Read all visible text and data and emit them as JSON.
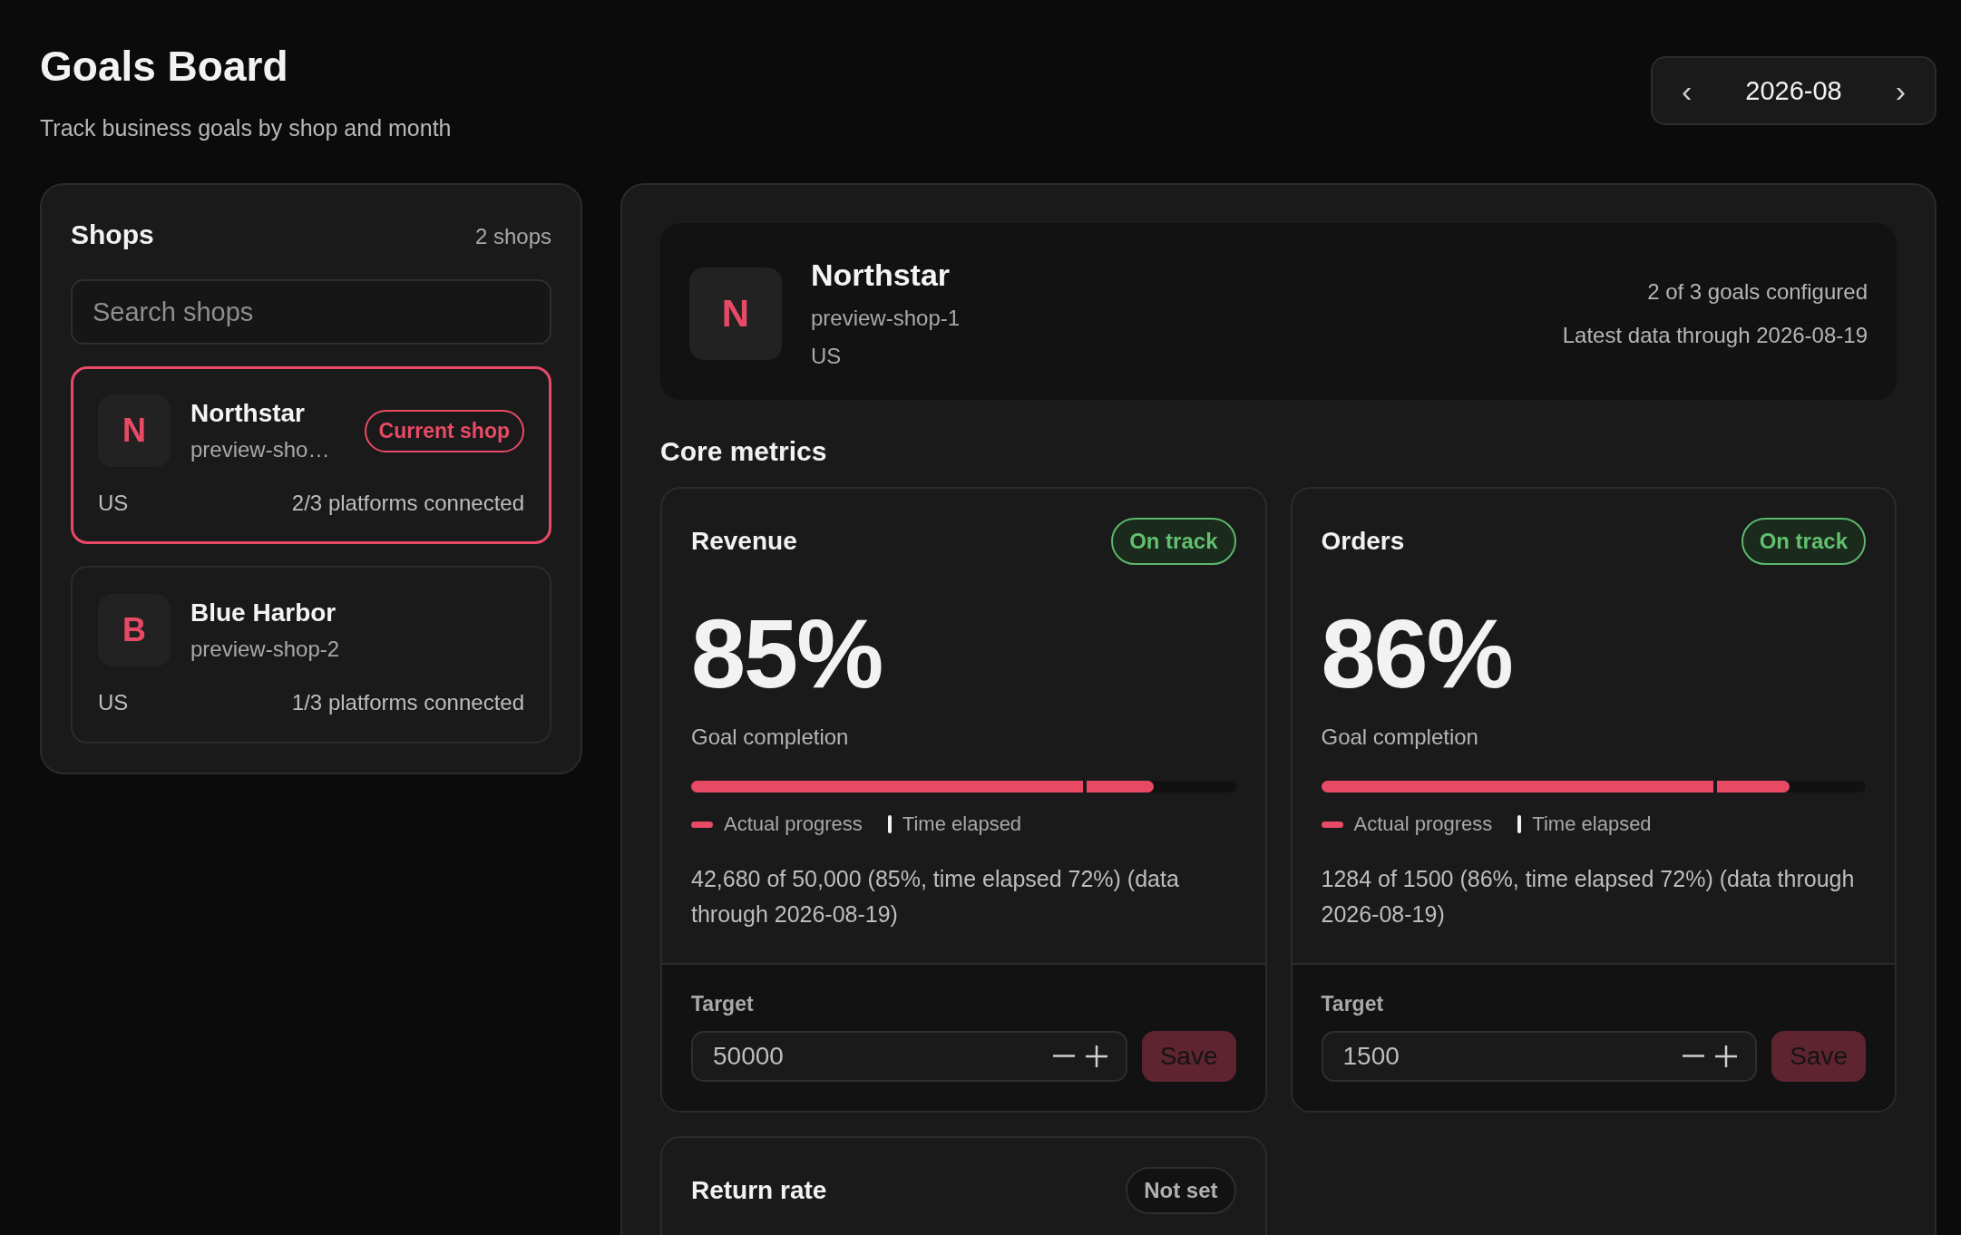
{
  "header": {
    "title": "Goals Board",
    "subtitle": "Track business goals by shop and month"
  },
  "month_nav": {
    "prev": "‹",
    "month": "2026-08",
    "next": "›"
  },
  "shops_panel": {
    "title": "Shops",
    "count": "2 shops",
    "search": {
      "placeholder": "Search shops"
    },
    "shops": [
      {
        "initial": "N",
        "name": "Northstar",
        "handle": "preview-sho…",
        "badge": "Current shop",
        "region": "US",
        "platforms": "2/3 platforms connected",
        "selected": true
      },
      {
        "initial": "B",
        "name": "Blue Harbor",
        "handle": "preview-shop-2",
        "region": "US",
        "platforms": "1/3 platforms connected",
        "selected": false
      }
    ]
  },
  "shop_summary": {
    "initial": "N",
    "name": "Northstar",
    "handle": "preview-shop-1",
    "region": "US",
    "goals": "2 of 3 goals configured",
    "latest": "Latest data through 2026-08-19"
  },
  "core_metrics": {
    "title": "Core metrics",
    "metrics": [
      {
        "name": "Revenue",
        "status": {
          "label": "On track",
          "kind": "on_track"
        },
        "percent": "85%",
        "caption": "Goal completion",
        "progress": {
          "level": 0.85
        },
        "time_marker": {
          "level": 0.72
        },
        "legend": [
          "Actual progress",
          "Time elapsed"
        ],
        "detail": "42,680 of 50,000 (85%, time elapsed 72%) (data through 2026-08-19)",
        "target_label": "Target",
        "target_value": "50000",
        "save": "Save"
      },
      {
        "name": "Orders",
        "status": {
          "label": "On track",
          "kind": "on_track"
        },
        "percent": "86%",
        "caption": "Goal completion",
        "progress": {
          "level": 0.86
        },
        "time_marker": {
          "level": 0.72
        },
        "legend": [
          "Actual progress",
          "Time elapsed"
        ],
        "detail": "1284 of 1500 (86%, time elapsed 72%) (data through 2026-08-19)",
        "target_label": "Target",
        "target_value": "1500",
        "save": "Save"
      },
      {
        "name": "Return rate",
        "status": {
          "label": "Not set",
          "kind": "not_set"
        }
      }
    ]
  }
}
